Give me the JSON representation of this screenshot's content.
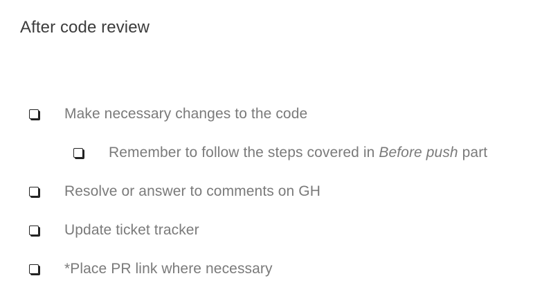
{
  "heading": "After code review",
  "checklist": [
    {
      "text": "Make necessary changes to the code",
      "checked": false,
      "level": 0
    },
    {
      "text_before": "Remember to follow the steps covered in ",
      "text_emphasis": "Before push",
      "text_after": " part",
      "checked": false,
      "level": 1
    },
    {
      "text": "Resolve or answer to comments on GH",
      "checked": false,
      "level": 0
    },
    {
      "text": "Update ticket tracker",
      "checked": false,
      "level": 0
    },
    {
      "text": "*Place PR link where necessary",
      "checked": false,
      "level": 0
    }
  ],
  "colors": {
    "heading": "#3c3c3c",
    "item_text": "#7a7a7a",
    "checkbox": "#222222"
  }
}
